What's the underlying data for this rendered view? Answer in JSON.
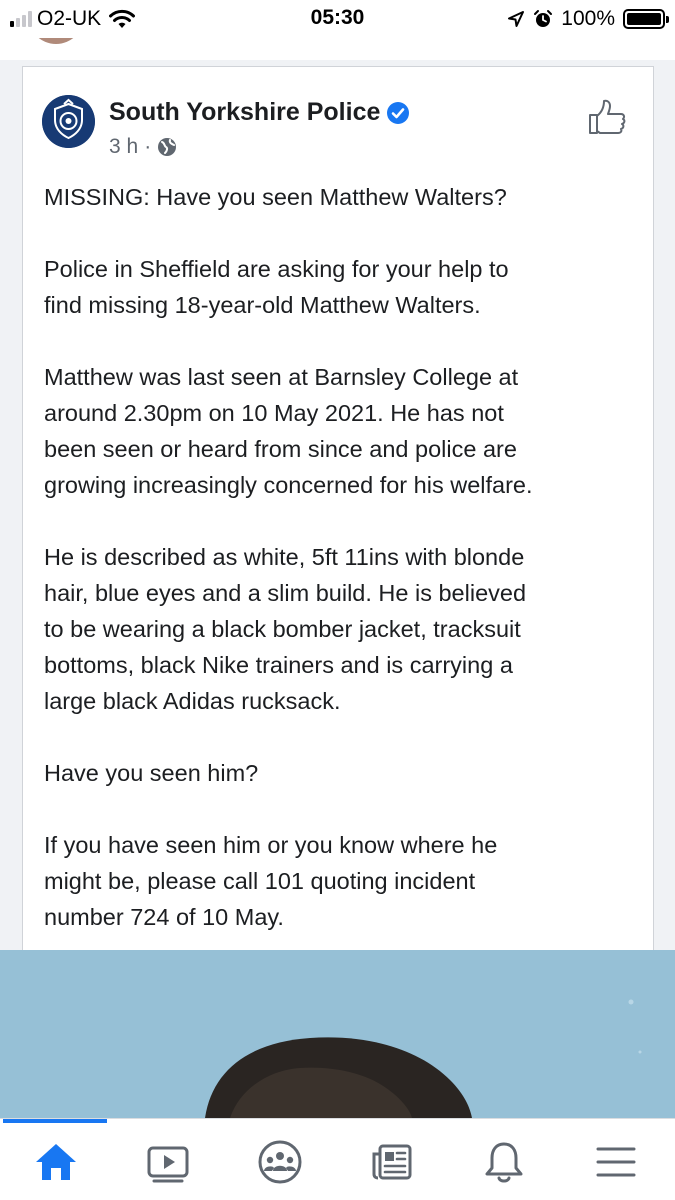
{
  "status_bar": {
    "carrier": "O2-UK",
    "time": "05:30",
    "battery_percent": "100%",
    "battery_level": 1.0,
    "signal_bars_filled": 1
  },
  "post": {
    "page_name": "South Yorkshire Police",
    "verified": true,
    "time_ago": "3 h",
    "separator": "·",
    "privacy_icon": "globe-icon",
    "paragraphs": [
      "MISSING: Have you seen Matthew Walters?",
      "Police in Sheffield are asking for your help to\nfind missing 18-year-old Matthew Walters.",
      "Matthew was last seen at Barnsley College at\naround 2.30pm on 10 May 2021. He has not\nbeen seen or heard from since and police are\ngrowing increasingly concerned for his welfare.",
      "He is described as white, 5ft 11ins with blonde\nhair, blue eyes and a slim build. He is believed\nto be wearing a black bomber jacket, tracksuit\nbottoms, black Nike trainers and is carrying a\nlarge black Adidas rucksack.",
      "Have you seen him?",
      "If you have seen him or you know where he\nmight be, please call 101 quoting incident\nnumber 724 of 10 May."
    ]
  },
  "tab_bar": {
    "active_tab": "home",
    "tabs": [
      "home-icon",
      "watch-icon",
      "groups-icon",
      "news-feed-icon",
      "notifications-icon",
      "menu-icon"
    ]
  },
  "colors": {
    "accent": "#1877f2",
    "verified_badge": "#1877f2",
    "text_primary": "#1c1e21",
    "text_secondary": "#606770",
    "icon_gray": "#606770",
    "police_badge": "#173a74",
    "photo_sky": "#9cc4d9"
  }
}
